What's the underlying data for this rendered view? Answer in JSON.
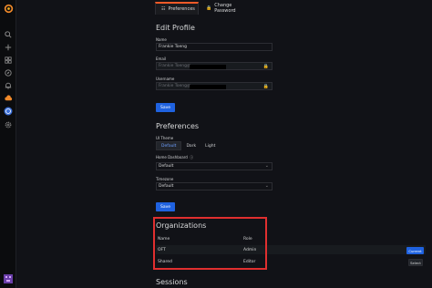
{
  "tabs": {
    "preferences": "Preferences",
    "change_password": "Change Password"
  },
  "edit_profile": {
    "title": "Edit Profile",
    "name_label": "Name",
    "name_value": "Frankie Toeng",
    "email_label": "Email",
    "email_value": "Frankie Toeng@",
    "username_label": "Username",
    "username_value": "Frankie Toeng@",
    "save": "Save"
  },
  "preferences": {
    "title": "Preferences",
    "ui_theme_label": "UI Theme",
    "themes": [
      "Default",
      "Dark",
      "Light"
    ],
    "selected_theme": "Default",
    "home_dashboard_label": "Home Dashboard",
    "home_dashboard_value": "Default",
    "timezone_label": "Timezone",
    "timezone_value": "Default",
    "save": "Save"
  },
  "organizations": {
    "title": "Organizations",
    "headers": {
      "name": "Name",
      "role": "Role"
    },
    "rows": [
      {
        "name": "OFT",
        "role": "Admin",
        "action": "Current"
      },
      {
        "name": "Shared",
        "role": "Editor",
        "action": "Select"
      }
    ]
  },
  "sessions": {
    "title": "Sessions"
  },
  "colors": {
    "accent": "#1f62e0",
    "highlight_box": "#e02f2f",
    "active_tab_border": "#f05a28"
  }
}
